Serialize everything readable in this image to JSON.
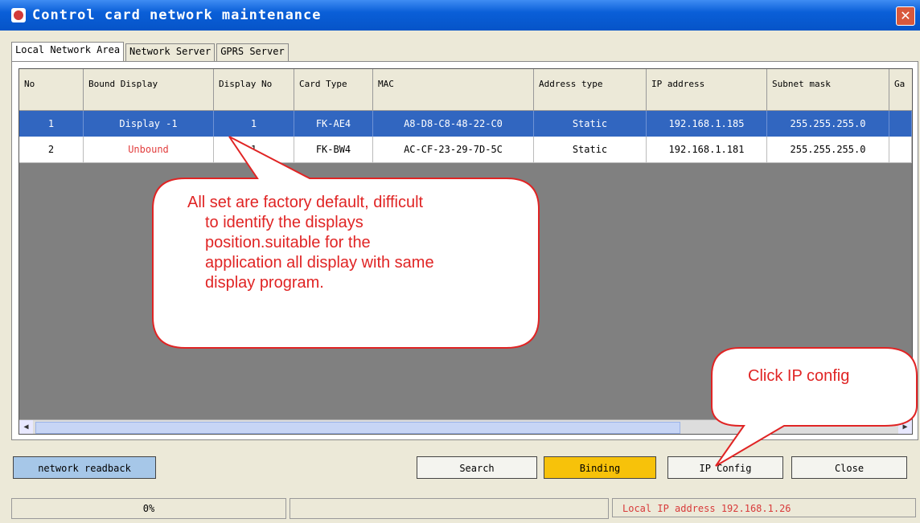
{
  "window": {
    "title": "Control card network maintenance",
    "close_symbol": "✕"
  },
  "tabs": [
    "Local Network Area",
    "Network Server",
    "GPRS Server"
  ],
  "table": {
    "columns": [
      "No",
      "Bound Display",
      "Display No",
      "Card Type",
      "MAC",
      "Address type",
      "IP address",
      "Subnet mask",
      "Ga"
    ],
    "rows": [
      {
        "no": "1",
        "bound": "Display -1",
        "display_no": "1",
        "card": "FK-AE4",
        "mac": "A8-D8-C8-48-22-C0",
        "addr": "Static",
        "ip": "192.168.1.185",
        "subnet": "255.255.255.0"
      },
      {
        "no": "2",
        "bound": "Unbound",
        "display_no": "1",
        "card": "FK-BW4",
        "mac": "AC-CF-23-29-7D-5C",
        "addr": "Static",
        "ip": "192.168.1.181",
        "subnet": "255.255.255.0"
      }
    ]
  },
  "buttons": {
    "readback": "network readback",
    "search": "Search",
    "binding": "Binding",
    "ipconfig": "IP Config",
    "close": "Close"
  },
  "status": {
    "progress": "0%",
    "local_ip": "Local IP address 192.168.1.26"
  },
  "callouts": {
    "main": [
      "All set are factory default, difficult",
      "to identify the displays",
      "position.suitable for the",
      "application all display with same",
      "display program."
    ],
    "ip": "Click IP config"
  },
  "colors": {
    "accent": "#0654c8",
    "selected_row": "#3166c0",
    "binding": "#f7c20a",
    "callout_text": "#e02424"
  }
}
